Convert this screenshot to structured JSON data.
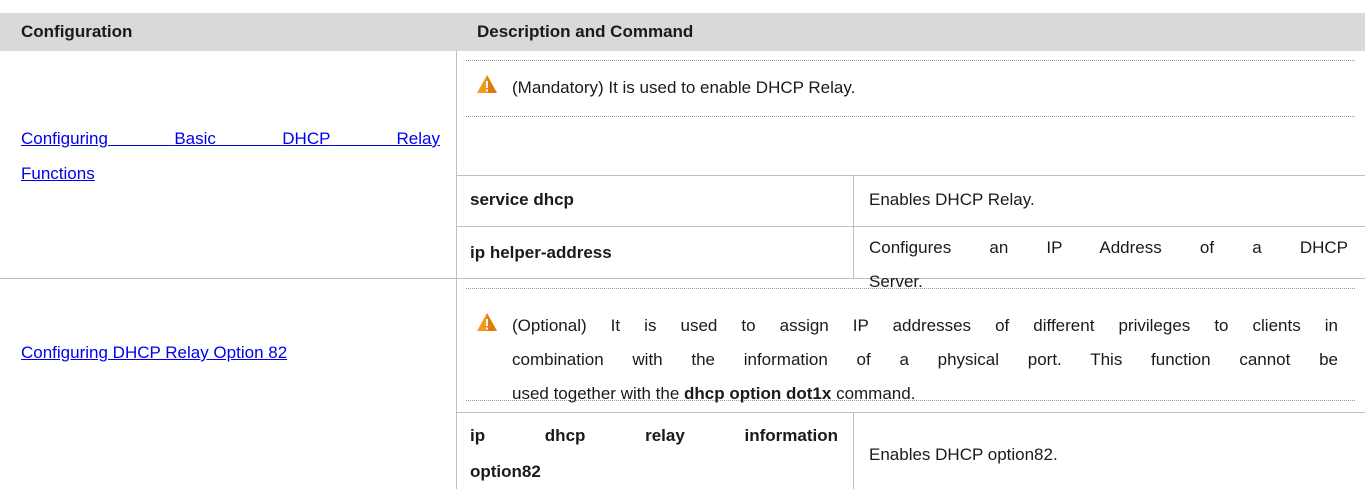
{
  "header": {
    "col1": "Configuration",
    "col2": "Description and Command"
  },
  "rows": [
    {
      "config_line1": [
        "Configuring",
        "Basic",
        "DHCP",
        "Relay"
      ],
      "config_line2": "Functions",
      "note": "(Mandatory) It is used to enable DHCP Relay.",
      "commands": [
        {
          "cmd": "service dhcp",
          "desc": "Enables DHCP Relay."
        },
        {
          "cmd": "ip helper-address",
          "desc_line1": [
            "Configures",
            "an",
            "IP",
            "Address",
            "of",
            "a",
            "DHCP"
          ],
          "desc_line2": "Server."
        }
      ]
    },
    {
      "config": "Configuring DHCP Relay Option 82",
      "note_line1": "(Optional) It is used to assign IP addresses of different privileges to clients in",
      "note_line2": "combination with the information of a physical port. This function cannot be",
      "note_line3_pre": "used together with the ",
      "note_line3_kw": "dhcp option dot1x",
      "note_line3_post": " command.",
      "commands": [
        {
          "cmd_line1": [
            "ip",
            "dhcp",
            "relay",
            "information"
          ],
          "cmd_line2": "option82",
          "desc": "Enables DHCP option82."
        }
      ]
    }
  ],
  "icons": {
    "warning": "warning-triangle-icon",
    "warning_color": "#f39a1e"
  }
}
